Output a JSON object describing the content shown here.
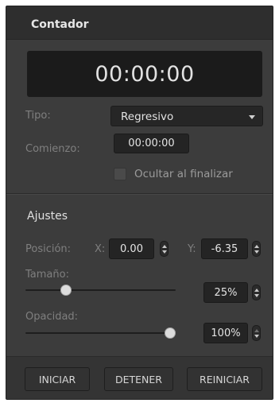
{
  "panel": {
    "title": "Contador"
  },
  "timer": {
    "display": "00:00:00"
  },
  "type": {
    "label": "Tipo:",
    "value": "Regresivo"
  },
  "start": {
    "label": "Comienzo:",
    "value": "00:00:00"
  },
  "hide_on_finish": {
    "label": "Ocultar al finalizar",
    "checked": false
  },
  "settings": {
    "title": "Ajustes",
    "position": {
      "label": "Posición:",
      "x_label": "X:",
      "x_value": "0.00",
      "y_label": "Y:",
      "y_value": "-6.35"
    },
    "size": {
      "label": "Tamaño:",
      "value": "25%",
      "level": 0.25
    },
    "opacity": {
      "label": "Opacidad:",
      "value": "100%",
      "level": 1.0
    }
  },
  "buttons": {
    "start": "INICIAR",
    "stop": "DETENER",
    "reset": "REINICIAR"
  },
  "colors": {
    "panel": "#3c3c3c",
    "header": "#2e2e2e",
    "display": "#1b1b1b",
    "thumb": "#dcdcdc"
  }
}
